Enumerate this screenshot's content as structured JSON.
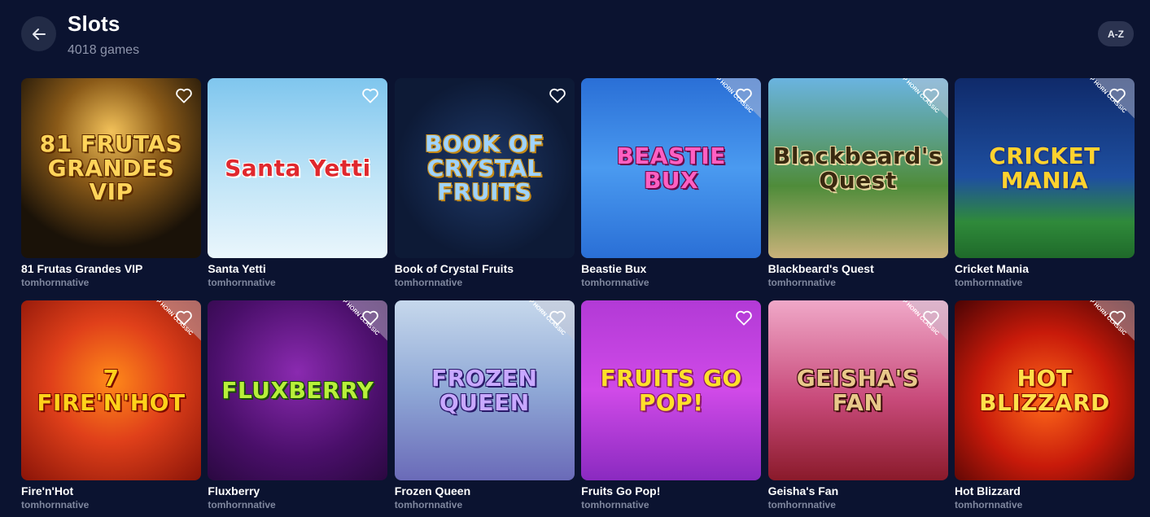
{
  "header": {
    "title": "Slots",
    "count": "4018 games",
    "sort_label": "A-Z"
  },
  "games": [
    {
      "name": "81 Frutas Grandes VIP",
      "provider": "tomhornnative",
      "art": "81 FRUTAS GRANDES VIP",
      "ribbon": "",
      "bg": "radial-gradient(circle at 50% 30%, #f3c25a 0%, #8a5a18 35%, #1a1208 75%)",
      "text": "#ffd45a",
      "stroke": "#5a2a00"
    },
    {
      "name": "Santa Yetti",
      "provider": "tomhornnative",
      "art": "Santa Yetti",
      "ribbon": "",
      "bg": "linear-gradient(180deg, #7fc6ee 0%, #bfe4f7 55%, #eaf6fc 100%)",
      "text": "#e0282e",
      "stroke": "#ffffff"
    },
    {
      "name": "Book of Crystal Fruits",
      "provider": "tomhornnative",
      "art": "BOOK OF CRYSTAL FRUITS",
      "ribbon": "",
      "bg": "radial-gradient(circle at 50% 50%, #1f3a6a 0%, #0d1a36 70%)",
      "text": "#9fd3ff",
      "stroke": "#c78a14"
    },
    {
      "name": "Beastie Bux",
      "provider": "tomhornnative",
      "art": "BEASTIE BUX",
      "ribbon": "TOP HORN CLASSIC",
      "bg": "linear-gradient(180deg, #2a6fd6 0%, #4a9af0 50%, #2a6fd6 100%)",
      "text": "#ff5fc2",
      "stroke": "#6a0a4a"
    },
    {
      "name": "Blackbeard's Quest",
      "provider": "tomhornnative",
      "art": "Blackbeard's Quest",
      "ribbon": "TOP HORN CLASSIC",
      "bg": "linear-gradient(180deg, #6ab4e0 0%, #4f8c3a 60%, #c9b27a 100%)",
      "text": "#3a2a10",
      "stroke": "#e8d7a0"
    },
    {
      "name": "Cricket Mania",
      "provider": "tomhornnative",
      "art": "CRICKET MANIA",
      "ribbon": "TOP HORN CLASSIC",
      "bg": "linear-gradient(180deg, #0f2a6a 0%, #1e4fa0 55%, #2f8a3a 80%, #1f6a2a 100%)",
      "text": "#ffd22e",
      "stroke": "#1a3a8a"
    },
    {
      "name": "Fire'n'Hot",
      "provider": "tomhornnative",
      "art": "7 FIRE'N'HOT",
      "ribbon": "TOP HORN CLASSIC",
      "bg": "radial-gradient(circle at 50% 45%, #ff8a1a 0%, #e0401a 45%, #8a1408 100%)",
      "text": "#ffd21a",
      "stroke": "#7a0a00"
    },
    {
      "name": "Fluxberry",
      "provider": "tomhornnative",
      "art": "FLUXBERRY",
      "ribbon": "TOP HORN CLASSIC",
      "bg": "radial-gradient(circle at 50% 40%, #8a2ab0 0%, #4a0f6a 60%, #2a0840 100%)",
      "text": "#b8f03a",
      "stroke": "#1a4a0a"
    },
    {
      "name": "Frozen Queen",
      "provider": "tomhornnative",
      "art": "FROZEN QUEEN",
      "ribbon": "TOP HORN CLASSIC",
      "bg": "linear-gradient(180deg, #c6d8ec 0%, #8fa8d6 50%, #6a6ab8 100%)",
      "text": "#c8a8ff",
      "stroke": "#2a1a6a"
    },
    {
      "name": "Fruits Go Pop!",
      "provider": "tomhornnative",
      "art": "FRUITS GO POP!",
      "ribbon": "",
      "bg": "linear-gradient(180deg, #b23ad6 0%, #d04ae8 50%, #8a2ac0 100%)",
      "text": "#ffe02a",
      "stroke": "#8a1a6a"
    },
    {
      "name": "Geisha's Fan",
      "provider": "tomhornnative",
      "art": "GEISHA'S FAN",
      "ribbon": "TOP HORN CLASSIC",
      "bg": "linear-gradient(180deg, #f0a8c8 0%, #c84a7a 55%, #8a1a2a 100%)",
      "text": "#e8c88a",
      "stroke": "#3a0a0a"
    },
    {
      "name": "Hot Blizzard",
      "provider": "tomhornnative",
      "art": "HOT BLIZZARD",
      "ribbon": "TOP HORN CLASSIC",
      "bg": "radial-gradient(circle at 50% 55%, #ff6a1a 0%, #c81a0a 50%, #4a0404 100%)",
      "text": "#ffe04a",
      "stroke": "#8a0a00"
    }
  ],
  "icons": {
    "back": "arrow-left-icon",
    "favorite": "heart-icon"
  }
}
